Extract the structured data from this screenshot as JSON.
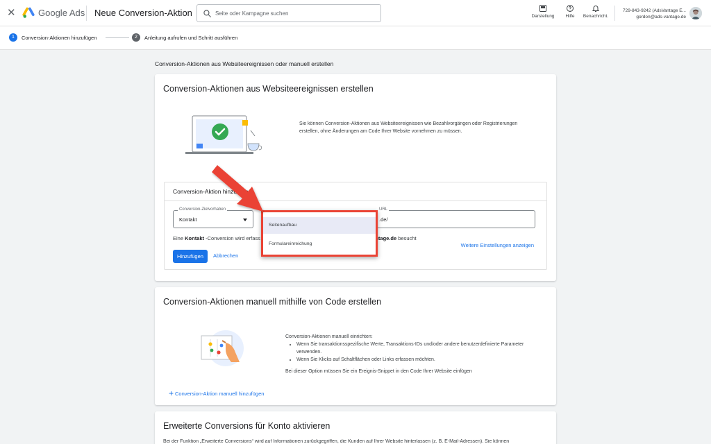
{
  "header": {
    "close_label": "✕",
    "brand": "Google Ads",
    "page_title": "Neue Conversion-Aktion",
    "search_placeholder": "Seite oder Kampagne suchen",
    "tools": [
      {
        "label": "Darstellung",
        "icon": "appearance-icon"
      },
      {
        "label": "Hilfe",
        "icon": "help-icon"
      },
      {
        "label": "Benachricht.",
        "icon": "bell-icon"
      }
    ],
    "account_line1": "729-843-9242 (AdsVantage E...",
    "account_line2": "gordon@ads-vantage.de"
  },
  "stepper": {
    "steps": [
      {
        "number": "1",
        "label": "Conversion-Aktionen hinzufügen",
        "active": true
      },
      {
        "number": "2",
        "label": "Anleitung aufrufen und Schritt ausführen",
        "active": false
      }
    ]
  },
  "main": {
    "section_heading": "Conversion-Aktionen aus Websiteereignissen oder manuell erstellen",
    "website_card": {
      "title": "Conversion-Aktionen aus Websiteereignissen erstellen",
      "description": "Sie können Conversion-Aktionen aus Websiteereignissen wie Bezahlvorgängen oder Registrierungen erstellen, ohne Änderungen am Code Ihrer Website vornehmen zu müssen.",
      "inner_title": "Conversion-Aktion hinzufügen",
      "goal_field": {
        "legend": "Conversion-Zielvorhaben",
        "value": "Kontakt"
      },
      "url_field": {
        "legend": "URL",
        "value": ".de/"
      },
      "helper_prefix": "Eine ",
      "helper_bold": "Kontakt",
      "helper_middle": " -Conversion wird erfass",
      "helper_domain": "vantage.de",
      "helper_suffix": " besucht",
      "more_settings": "Weitere Einstellungen anzeigen",
      "add_button": "Hinzufügen",
      "cancel_button": "Abbrechen",
      "dropdown_options": [
        "Seitenaufbau",
        "Formulareinreichung"
      ],
      "selected_option": "Seitenaufbau"
    },
    "manual_card": {
      "title": "Conversion-Aktionen manuell mithilfe von Code erstellen",
      "intro": "Conversion-Aktionen manuell einrichten:",
      "bullets": [
        "Wenn Sie transaktionsspezifische Werte, Transaktions-IDs und/oder andere benutzerdefinierte Parameter verwenden.",
        "Wenn Sie Klicks auf Schaltflächen oder Links erfassen möchten."
      ],
      "note": "Bei dieser Option müssen Sie ein Ereignis-Snippet in den Code Ihrer Website einfügen",
      "add_link": "Conversion-Aktion manuell hinzufügen"
    },
    "enhanced_card": {
      "title": "Erweiterte Conversions für Konto aktivieren",
      "text": "Bei der Funktion „Erweiterte Conversions“ wird auf Informationen zurückgegriffen, die Kunden auf Ihrer Website hinterlassen (z. B. E-Mail-Adressen). Sie können"
    }
  },
  "colors": {
    "primary": "#1a73e8",
    "annotation_red": "#ea4335",
    "background": "#f1f3f4"
  }
}
